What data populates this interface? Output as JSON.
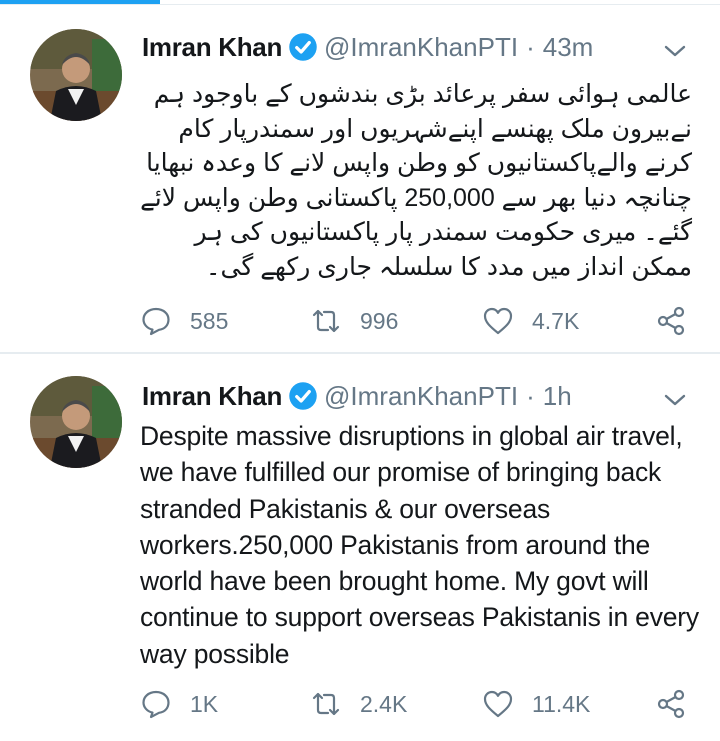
{
  "tweets": [
    {
      "author_name": "Imran Khan",
      "handle": "@ImranKhanPTI",
      "separator": "·",
      "time": "43m",
      "text": "عالمی ہوائی سفر پرعائد بڑی بندشوں کے باوجود ہم نےبیرون ملک پھنسے اپنےشہریوں اور سمندرپار کام کرنے والےپاکستانیوں کو وطن واپس لانے کا وعدہ نبھایا چنانچہ دنیا بھر سے 250,000 پاکستانی وطن واپس لائے گئے۔ میری حکومت سمندر پار پاکستانیوں کی ہر ممکن انداز میں مدد کا سلسلہ جاری رکھے گی۔",
      "replies": "585",
      "retweets": "996",
      "likes": "4.7K"
    },
    {
      "author_name": "Imran Khan",
      "handle": "@ImranKhanPTI",
      "separator": "·",
      "time": "1h",
      "text": "Despite massive disruptions in global air travel, we have fulfilled our promise of bringing back stranded Pakistanis & our overseas workers.250,000 Pakistanis from around the world have been brought home. My govt will continue to support overseas Pakistanis  in every way possible",
      "replies": "1K",
      "retweets": "2.4K",
      "likes": "11.4K"
    }
  ],
  "icons": {
    "verified": "verified-badge-icon",
    "menu": "chevron-down-icon",
    "reply": "reply-icon",
    "retweet": "retweet-icon",
    "like": "heart-icon",
    "share": "share-icon"
  },
  "colors": {
    "accent": "#1da1f2",
    "secondary_text": "#657786",
    "primary_text": "#14171a",
    "divider": "#e6ecf0"
  }
}
